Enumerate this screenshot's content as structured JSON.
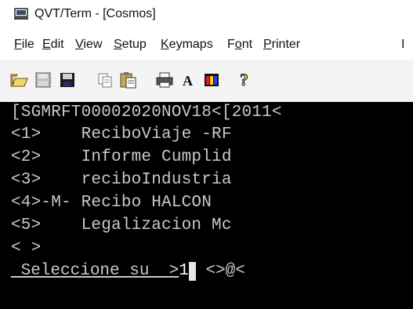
{
  "window": {
    "title": "QVT/Term - [Cosmos]"
  },
  "menu": [
    {
      "pre": "",
      "acc": "F",
      "post": "ile"
    },
    {
      "pre": "",
      "acc": "E",
      "post": "dit"
    },
    {
      "pre": "",
      "acc": "V",
      "post": "iew"
    },
    {
      "pre": "",
      "acc": "S",
      "post": "etup"
    },
    {
      "pre": "",
      "acc": "K",
      "post": "eymaps"
    },
    {
      "pre": "F",
      "acc": "o",
      "post": "nt"
    },
    {
      "pre": "",
      "acc": "P",
      "post": "rinter"
    },
    {
      "pre": "",
      "acc": "",
      "post": "I"
    }
  ],
  "toolbar_icons": [
    "open-folder-icon",
    "disk-icon",
    "save-icon",
    "copy-icon",
    "paste-icon",
    "print-icon",
    "font-icon",
    "color-icon",
    "help-icon"
  ],
  "terminal": {
    "lines": [
      "[SGMRFT00002020NOV18<[2011<",
      "<1>    ReciboViaje -RF",
      "<2>    Informe Cumplid",
      "<3>    reciboIndustria",
      "<4>-M- Recibo HALCON",
      "<5>    Legalizacion Mc",
      "< >"
    ],
    "prompt": " Seleccione su  >",
    "input_value": "1",
    "prompt_suffix": " <>@<"
  },
  "colors": {
    "terminal_bg": "#000000",
    "terminal_fg": "#c8c8c8"
  }
}
